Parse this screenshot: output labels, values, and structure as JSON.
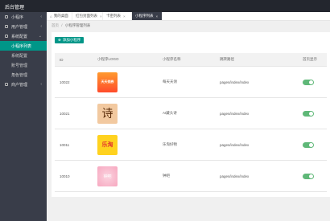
{
  "app": {
    "title": "后台管理"
  },
  "sidebar": {
    "items": [
      {
        "label": "小程序"
      },
      {
        "label": "用户管理"
      },
      {
        "label": "系统配置"
      },
      {
        "label": "小程序列表"
      },
      {
        "label": "系统配置"
      },
      {
        "label": "账号管理"
      },
      {
        "label": "角色管理"
      },
      {
        "label": "商户管理"
      }
    ]
  },
  "tabs": [
    {
      "label": "我的桌面"
    },
    {
      "label": "红包封面列表"
    },
    {
      "label": "卡密列表"
    },
    {
      "label": "小程序列表"
    }
  ],
  "breadcrumb": {
    "home": "首页",
    "sep": "/",
    "current": "小程序管理列表"
  },
  "toolbar": {
    "add_label": "添加小程序"
  },
  "table": {
    "headers": [
      "ID",
      "小程序LOGO",
      "小程序名称",
      "跳转路径",
      "首页显示"
    ],
    "rows": [
      {
        "id": "10022",
        "logo_text": "天天领券",
        "name": "每天天领",
        "path": "pages/index/index",
        "show": true
      },
      {
        "id": "10021",
        "logo_text": "诗",
        "name": "AI藏头诗",
        "path": "pages/index/index",
        "show": true
      },
      {
        "id": "10011",
        "logo_text": "乐淘",
        "name": "乐淘好物",
        "path": "pages/index/index",
        "show": true
      },
      {
        "id": "10010",
        "logo_text": "钟吧",
        "name": "钟吧",
        "path": "pages/index/index",
        "show": true
      }
    ]
  },
  "colors": {
    "accent": "#009688",
    "toggle_on": "#5fb878",
    "sidebar_bg": "#393d49",
    "header_bg": "#23262e"
  }
}
